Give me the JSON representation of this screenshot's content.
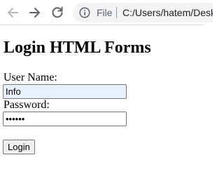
{
  "browser": {
    "scheme_label": "File",
    "url": "C:/Users/hatem/Desktop/login.html"
  },
  "page": {
    "title": "Login HTML Forms"
  },
  "form": {
    "username_label": "User Name:",
    "username_value": "Info",
    "password_label": "Password:",
    "password_value": "123456",
    "submit_label": "Login"
  }
}
